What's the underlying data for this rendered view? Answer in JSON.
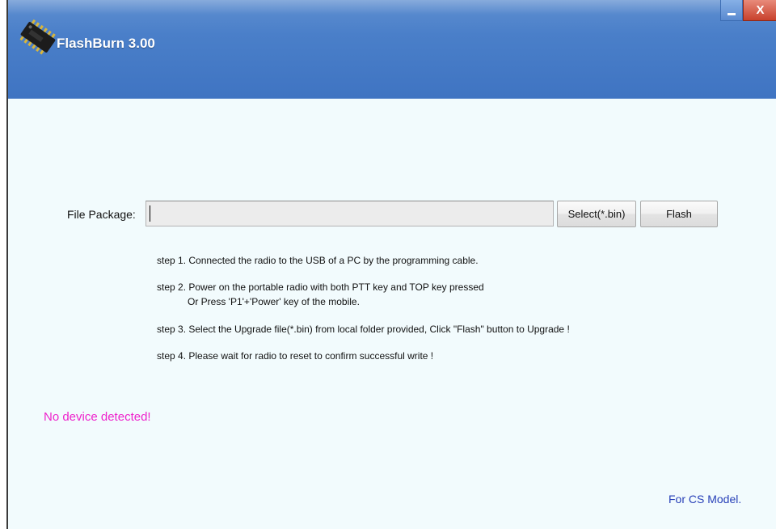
{
  "window": {
    "title": "FlashBurn 3.00",
    "minimize_glyph": "—",
    "close_glyph": "X",
    "icon": "chip-icon"
  },
  "file_package": {
    "label": "File Package:",
    "value": "",
    "placeholder": ""
  },
  "buttons": {
    "select_label": "Select(*.bin)",
    "flash_label": "Flash"
  },
  "steps": [
    {
      "text": "step 1. Connected the radio to the USB of a PC by  the programming cable."
    },
    {
      "text": "step 2. Power on the portable radio with both PTT key and TOP key pressed",
      "sub": "Or Press 'P1'+'Power' key of the mobile."
    },
    {
      "text": "step 3. Select the Upgrade file(*.bin)  from local folder provided, Click \"Flash\" button to Upgrade !"
    },
    {
      "text": "step 4. Please wait for radio to reset to confirm successful write !"
    }
  ],
  "status": "No device detected!",
  "model_note": "For CS Model.",
  "colors": {
    "titlebar": "#4a7fc9",
    "body": "#f2fbfd",
    "status": "#ee22cc",
    "model_note": "#2840b8"
  }
}
